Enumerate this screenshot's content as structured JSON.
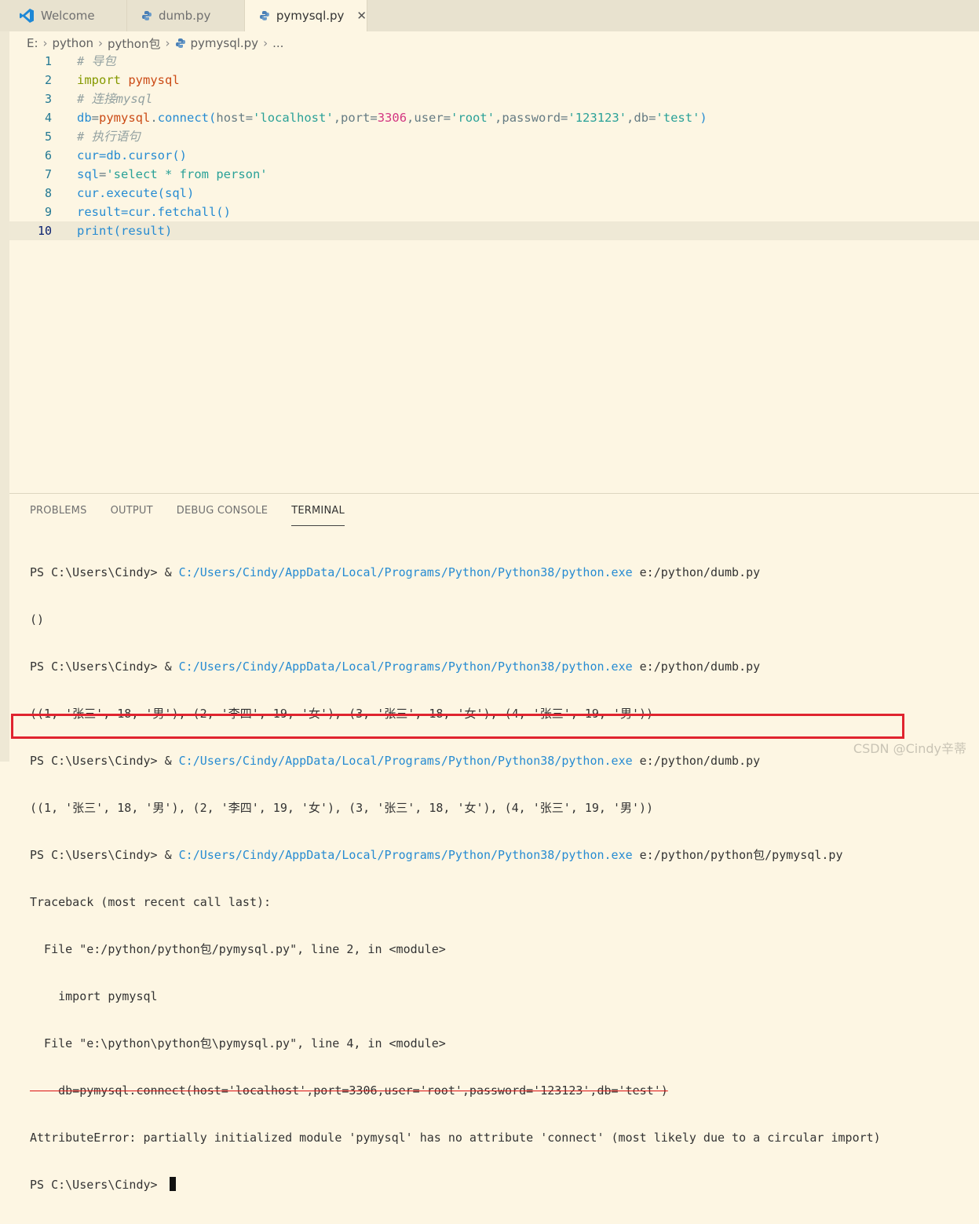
{
  "tabs": [
    {
      "label": "Welcome",
      "icon": "vscode-logo-icon"
    },
    {
      "label": "dumb.py",
      "icon": "python-file-icon"
    },
    {
      "label": "pymysql.py",
      "icon": "python-file-icon",
      "close": "✕"
    }
  ],
  "breadcrumb": {
    "drive": "E:",
    "folder1": "python",
    "folder2": "python包",
    "file": "pymysql.py",
    "more": "..."
  },
  "editor": {
    "current_line": 10,
    "lines": [
      {
        "num": "1",
        "comment": "# 导包"
      },
      {
        "num": "2",
        "kw": "import",
        "mod": "pymysql"
      },
      {
        "num": "3",
        "comment": "# 连接mysql"
      },
      {
        "num": "4",
        "db": "db",
        "eq": "=",
        "mod": "pymysql",
        "dot": ".",
        "fn": "connect",
        "open": "(",
        "host_k": "host",
        "host_v": "'localhost'",
        "port_k": "port",
        "port_v": "3306",
        "user_k": "user",
        "user_v": "'root'",
        "pass_k": "password",
        "pass_v": "'123123'",
        "db_k": "db",
        "db_v": "'test'",
        "close": ")"
      },
      {
        "num": "5",
        "comment": "# 执行语句"
      },
      {
        "num": "6",
        "text": "cur=db.cursor()"
      },
      {
        "num": "7",
        "var": "sql",
        "str": "'select * from person'"
      },
      {
        "num": "8",
        "text": "cur.execute(sql)"
      },
      {
        "num": "9",
        "text": "result=cur.fetchall()"
      },
      {
        "num": "10",
        "text": "print(result)"
      }
    ]
  },
  "panel": {
    "tabs": [
      "PROBLEMS",
      "OUTPUT",
      "DEBUG CONSOLE",
      "TERMINAL"
    ],
    "active_tab": "TERMINAL"
  },
  "terminal": {
    "prompt": "PS C:\\Users\\Cindy> & ",
    "exe": "C:/Users/Cindy/AppData/Local/Programs/Python/Python38/python.exe",
    "run1": " e:/python/dumb.py",
    "out1": "()",
    "out2": "((1, '张三', 18, '男'), (2, '李四', 19, '女'), (3, '张三', 18, '女'), (4, '张三', 19, '男'))",
    "run4": " e:/python/python包/pymysql.py",
    "tb0": "Traceback (most recent call last):",
    "tb1": "  File \"e:/python/python包/pymysql.py\", line 2, in <module>",
    "tb2": "    import pymysql",
    "tb3": "  File \"e:\\python\\python包\\pymysql.py\", line 4, in <module>",
    "tb4": "    db=pymysql.connect(host='localhost',port=3306,user='root',password='123123',db='test')",
    "err": "AttributeError: partially initialized module 'pymysql' has no attribute 'connect' (most likely due to a circular import)",
    "last_prompt": "PS C:\\Users\\Cindy> "
  },
  "watermark": "CSDN @Cindy辛蒂"
}
